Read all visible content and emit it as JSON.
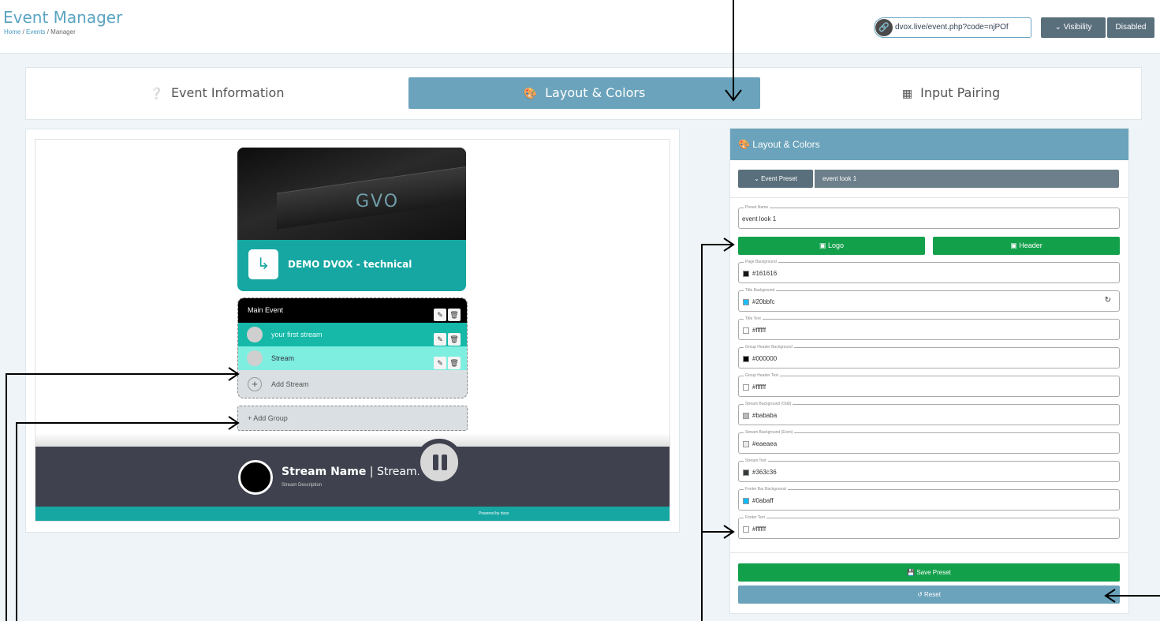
{
  "header": {
    "title": "Event Manager",
    "breadcrumb": [
      "Home",
      "Events",
      "Manager"
    ],
    "share_url": "dvox.live/event.php?code=njPOf",
    "visibility_label": "Visibility",
    "visibility_value": "Disabled"
  },
  "tabs": [
    {
      "label": "Event Information",
      "icon": "question-circle-icon"
    },
    {
      "label": "Layout & Colors",
      "icon": "palette-icon",
      "active": true
    },
    {
      "label": "Input Pairing",
      "icon": "network-icon"
    }
  ],
  "preview": {
    "event_title": "DEMO DVOX - technical",
    "hero_text": "GVO",
    "group": {
      "name": "Main Event",
      "streams": [
        "your first stream",
        "Stream"
      ],
      "add_stream_label": "Add Stream"
    },
    "add_group_label": "+ Add Group",
    "player": {
      "stream_name": "Stream Name",
      "stream_suffix": "| Stream..",
      "stream_description": "Stream Description"
    },
    "powered_by": "Powered by dvox"
  },
  "panel": {
    "title": "Layout & Colors",
    "preset_button": "Event Preset",
    "preset_value": "event look 1",
    "preset_name_label": "Preset Name",
    "preset_name_value": "event look 1",
    "logo_button": "Logo",
    "header_button": "Header",
    "colors": [
      {
        "label": "Page Background",
        "value": "#161616",
        "swatch": "#161616"
      },
      {
        "label": "Title Background",
        "value": "#20bbfc",
        "swatch": "#20bbfc",
        "reset": true
      },
      {
        "label": "Title Text",
        "value": "#ffffff",
        "swatch": "#ffffff"
      },
      {
        "label": "Group Header Background",
        "value": "#000000",
        "swatch": "#000000"
      },
      {
        "label": "Group Header Text",
        "value": "#ffffff",
        "swatch": "#ffffff"
      },
      {
        "label": "Stream Background (Odd)",
        "value": "#bababa",
        "swatch": "#bababa"
      },
      {
        "label": "Stream Background (Even)",
        "value": "#eaeaea",
        "swatch": "#eaeaea"
      },
      {
        "label": "Stream Text",
        "value": "#363c36",
        "swatch": "#363c36"
      },
      {
        "label": "Footer Bar Background",
        "value": "#0abaff",
        "swatch": "#0abaff"
      },
      {
        "label": "Footer Text",
        "value": "#ffffff",
        "swatch": "#ffffff"
      }
    ],
    "save_label": "Save Preset",
    "reset_label": "Reset"
  },
  "theme": {
    "accent": "#6aa3bb",
    "green": "#13a04b",
    "teal": "#16a7a3"
  }
}
